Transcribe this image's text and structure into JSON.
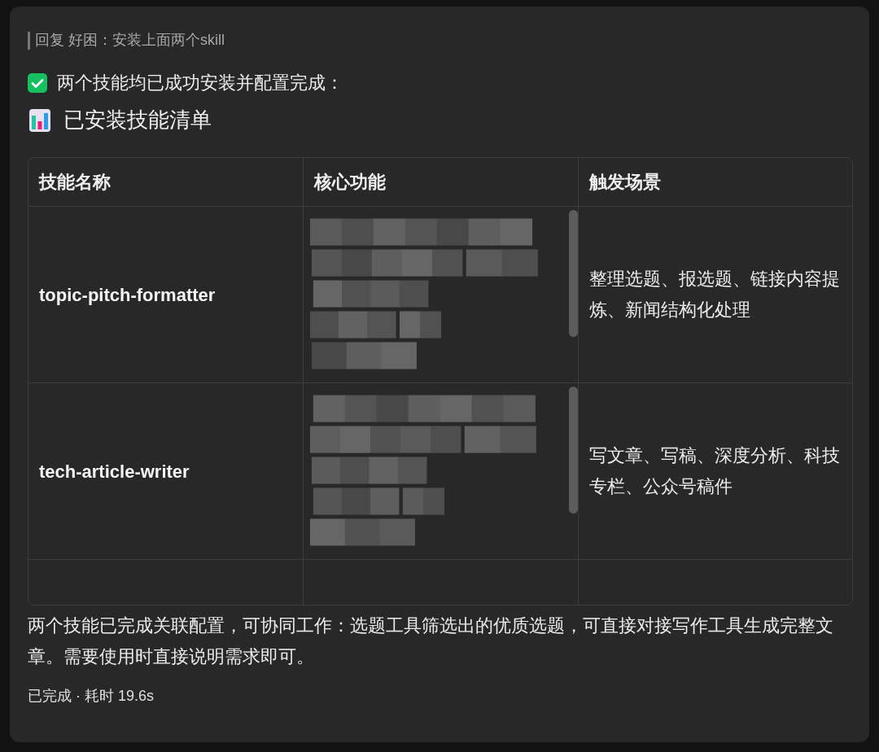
{
  "reply_quote": "回复 好困：安装上面两个skill",
  "status_line": "两个技能均已成功安装并配置完成：",
  "section_title": "已安装技能清单",
  "table": {
    "columns": [
      "技能名称",
      "核心功能",
      "触发场景"
    ],
    "rows": [
      {
        "name": "topic-pitch-formatter",
        "core": {
          "kind": "redacted"
        },
        "scene": "整理选题、报选题、链接内容提炼、新闻结构化处理"
      },
      {
        "name": "tech-article-writer",
        "core": {
          "kind": "redacted"
        },
        "scene": "写文章、写稿、深度分析、科技专栏、公众号稿件"
      }
    ]
  },
  "summary": "两个技能已完成关联配置，可协同工作：选题工具筛选出的优质选题，可直接对接写作工具生成完整文章。需要使用时直接说明需求即可。",
  "footer": "已完成 · 耗时 19.6s"
}
